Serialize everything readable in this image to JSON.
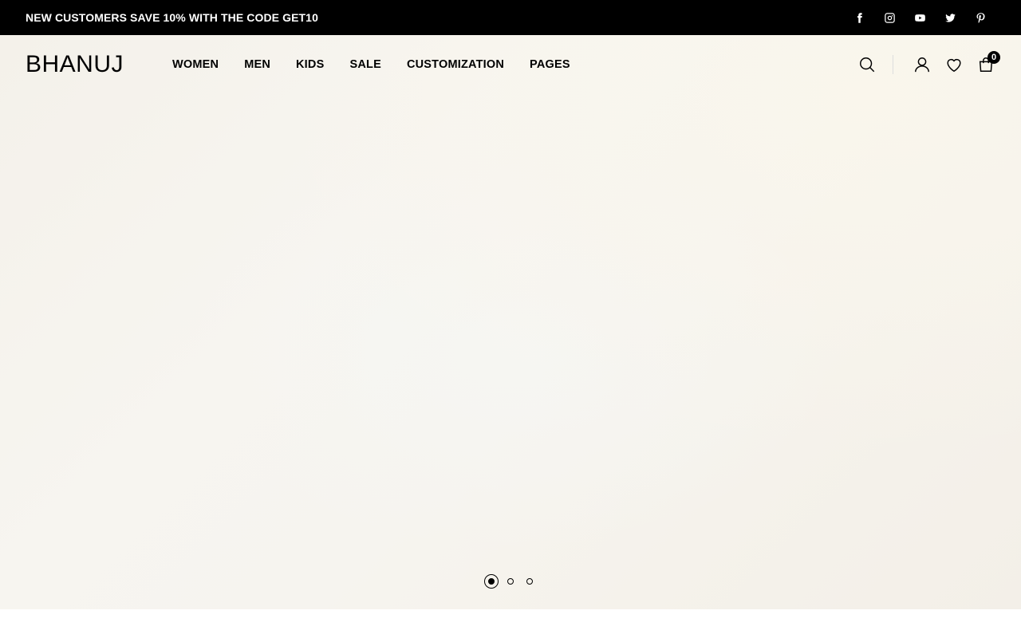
{
  "announcement": {
    "text": "NEW CUSTOMERS SAVE 10% WITH THE CODE GET10",
    "socials": [
      {
        "name": "facebook-icon"
      },
      {
        "name": "instagram-icon"
      },
      {
        "name": "youtube-icon"
      },
      {
        "name": "twitter-icon"
      },
      {
        "name": "pinterest-icon"
      }
    ]
  },
  "header": {
    "logo": "BHANUJ",
    "nav": [
      "WOMEN",
      "MEN",
      "KIDS",
      "SALE",
      "CUSTOMIZATION",
      "PAGES"
    ],
    "cart_count": "0"
  },
  "slider": {
    "slides": 3,
    "active": 1
  },
  "colors": {
    "announcement_bg": "#000000",
    "hero_bg": "#f6f4ef",
    "text": "#000000"
  }
}
